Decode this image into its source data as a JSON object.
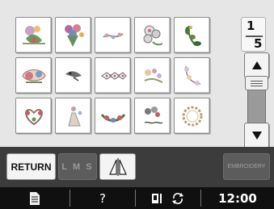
{
  "patterns": {
    "tiles": [
      {
        "row": 1,
        "col": 1,
        "icon": "floral-pattern-icon"
      },
      {
        "row": 1,
        "col": 2,
        "icon": "bouquet-pattern-icon"
      },
      {
        "row": 1,
        "col": 3,
        "icon": "vine-pattern-icon"
      },
      {
        "row": 1,
        "col": 4,
        "icon": "flower-cluster-pattern-icon"
      },
      {
        "row": 1,
        "col": 5,
        "icon": "leaf-spray-pattern-icon"
      },
      {
        "row": 2,
        "col": 1,
        "icon": "bow-scroll-pattern-icon"
      },
      {
        "row": 2,
        "col": 2,
        "icon": "bird-pattern-icon"
      },
      {
        "row": 2,
        "col": 3,
        "icon": "ornament-border-pattern-icon"
      },
      {
        "row": 2,
        "col": 4,
        "icon": "floral-spray-pattern-icon"
      },
      {
        "row": 2,
        "col": 5,
        "icon": "corner-flower-pattern-icon"
      },
      {
        "row": 3,
        "col": 1,
        "icon": "heart-scroll-pattern-icon"
      },
      {
        "row": 3,
        "col": 2,
        "icon": "figure-pattern-icon"
      },
      {
        "row": 3,
        "col": 3,
        "icon": "garland-pattern-icon"
      },
      {
        "row": 3,
        "col": 4,
        "icon": "bouquet-text-pattern-icon"
      },
      {
        "row": 3,
        "col": 5,
        "icon": "wreath-pattern-icon"
      }
    ]
  },
  "pagination": {
    "current": "1",
    "total": "5"
  },
  "scroll": {
    "up_icon": "arrow-up-icon",
    "down_icon": "arrow-down-icon"
  },
  "toolbar": {
    "return_label": "RETURN",
    "size_label": "L M S",
    "mirror_icon": "mirror-image-icon",
    "embroidery_label": "EMBROIDERY"
  },
  "status": {
    "doc_icon": "document-icon",
    "help_label": "?",
    "thread_icon": "presser-foot-icon",
    "rotate_icon": "rotate-icon",
    "time": "12:00"
  },
  "colors": {
    "screen": "#e6e6e6",
    "toolbar": "#3c3c3c",
    "statusbar": "#101010",
    "disabled_button": "#5c5c5c"
  }
}
